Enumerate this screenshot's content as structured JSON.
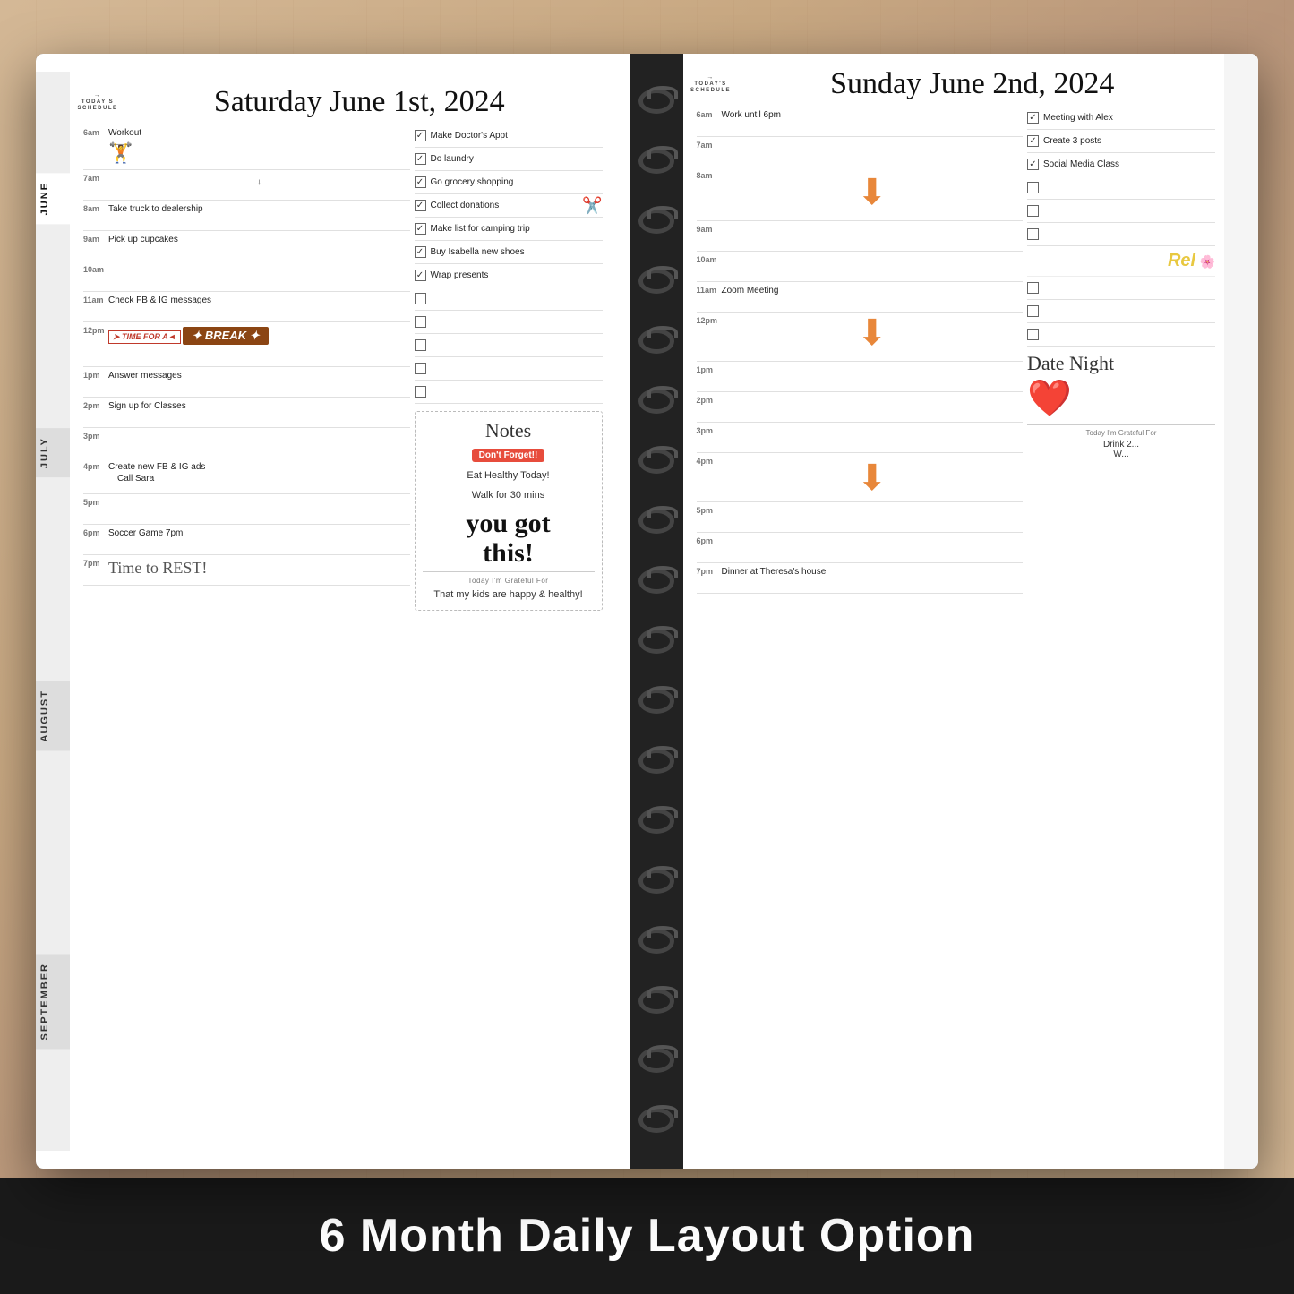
{
  "background": {
    "wood_color": "#c8a882"
  },
  "bottom_bar": {
    "title": "6 Month Daily Layout Option",
    "bg": "#1a1a1a",
    "text_color": "#ffffff"
  },
  "left_page": {
    "date": "Saturday June 1st, 2024",
    "today_schedule_label": "TODAY'S SCHEDULE",
    "schedule": [
      {
        "time": "6am",
        "event": "Workout",
        "has_dumbbell": true
      },
      {
        "time": "7am",
        "event": ""
      },
      {
        "time": "8am",
        "event": "Take truck to dealership"
      },
      {
        "time": "9am",
        "event": "Pick up cupcakes"
      },
      {
        "time": "10am",
        "event": ""
      },
      {
        "time": "11am",
        "event": "Check FB & IG messages"
      },
      {
        "time": "12pm",
        "event": "TIME FOR A BREAK",
        "special": "break"
      },
      {
        "time": "1pm",
        "event": "Answer messages"
      },
      {
        "time": "2pm",
        "event": "Sign up for Classes"
      },
      {
        "time": "3pm",
        "event": ""
      },
      {
        "time": "4pm",
        "event": "Create new FB & IG ads\nCall Sara"
      },
      {
        "time": "5pm",
        "event": ""
      },
      {
        "time": "6pm",
        "event": "Soccer Game 7pm"
      },
      {
        "time": "7pm",
        "event": "Time to REST!",
        "special": "rest"
      }
    ],
    "tasks": [
      {
        "label": "Make Doctor's Appt",
        "done": true
      },
      {
        "label": "Do laundry",
        "done": true
      },
      {
        "label": "Go grocery shopping",
        "done": true
      },
      {
        "label": "Collect donations",
        "done": true
      },
      {
        "label": "Make list for camping trip",
        "done": true
      },
      {
        "label": "Buy Isabella new shoes",
        "done": true
      },
      {
        "label": "Wrap presents",
        "done": true
      },
      {
        "label": "",
        "done": false
      },
      {
        "label": "",
        "done": false
      },
      {
        "label": "",
        "done": false
      },
      {
        "label": "",
        "done": false
      },
      {
        "label": "",
        "done": false
      }
    ],
    "notes": {
      "title": "Notes",
      "dont_forget": "Don't Forget!!",
      "items": [
        "Eat Healthy Today!",
        "Walk for 30 mins"
      ],
      "motivational": "you got this!",
      "grateful_label": "Today I'm Grateful For",
      "grateful_text": "That my kids are happy & healthy!"
    }
  },
  "right_page": {
    "date": "Sunday June 2nd, 2024",
    "today_schedule_label": "TODAY'S SCHEDULE",
    "schedule": [
      {
        "time": "6am",
        "event": "Work until 6pm"
      },
      {
        "time": "7am",
        "event": ""
      },
      {
        "time": "8am",
        "event": "",
        "special": "arrow"
      },
      {
        "time": "9am",
        "event": ""
      },
      {
        "time": "10am",
        "event": ""
      },
      {
        "time": "11am",
        "event": "Zoom Meeting"
      },
      {
        "time": "12pm",
        "event": "",
        "special": "arrow"
      },
      {
        "time": "1pm",
        "event": ""
      },
      {
        "time": "2pm",
        "event": ""
      },
      {
        "time": "3pm",
        "event": ""
      },
      {
        "time": "4pm",
        "event": "",
        "special": "arrow"
      },
      {
        "time": "5pm",
        "event": ""
      },
      {
        "time": "6pm",
        "event": ""
      },
      {
        "time": "7pm",
        "event": "Dinner at Theresa's house"
      }
    ],
    "tasks": [
      {
        "label": "Meeting with Alex",
        "done": true
      },
      {
        "label": "Create 3 posts",
        "done": true
      },
      {
        "label": "Social Media Class",
        "done": true
      },
      {
        "label": "",
        "done": false
      },
      {
        "label": "",
        "done": false
      },
      {
        "label": "",
        "done": false
      },
      {
        "label": "",
        "done": false
      },
      {
        "label": "",
        "done": false
      },
      {
        "label": "",
        "done": false
      },
      {
        "label": "",
        "done": false
      },
      {
        "label": "",
        "done": false
      },
      {
        "label": "",
        "done": false
      }
    ],
    "sidebar_decoration": "Relax",
    "date_night": "Date Night",
    "today_gratitude_label": "Today I'm Grateful For",
    "today_gratitude_items": [
      "Drink 2...",
      "W..."
    ]
  },
  "months": [
    "JUNE",
    "JULY",
    "AUGUST",
    "SEPTEMBER"
  ],
  "spiral_count": 18
}
